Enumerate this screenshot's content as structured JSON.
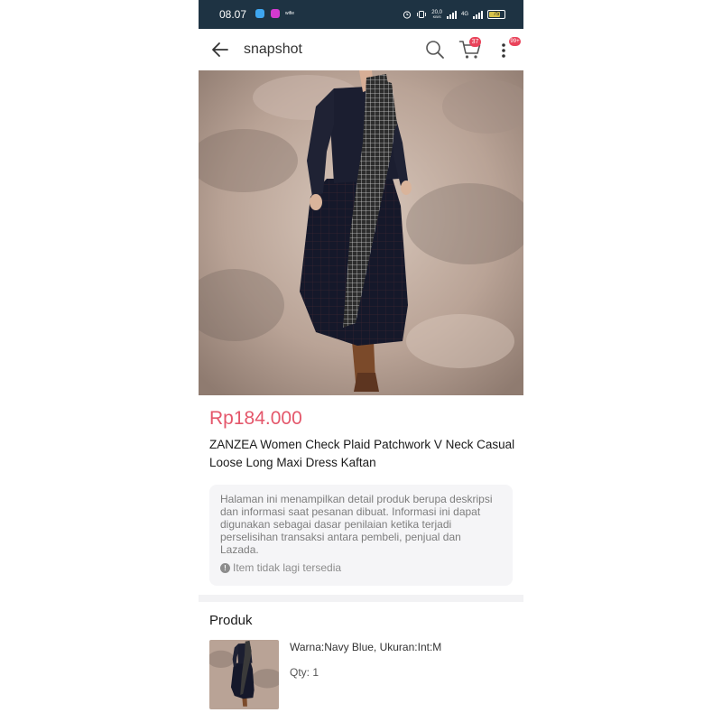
{
  "status_bar": {
    "time": "08.07",
    "wifi_name": "wifie",
    "speed_value": "20,0",
    "speed_unit": "KB/S",
    "network": "4G",
    "battery": "75",
    "battery_level_percent": 75
  },
  "header": {
    "title": "snapshot",
    "cart_count": "37",
    "notifications_count": "99+",
    "icons": [
      "arrow-left-icon",
      "search-icon",
      "cart-icon",
      "more-vertical-icon"
    ]
  },
  "product": {
    "price": "Rp184.000",
    "title": "ZANZEA Women Check Plaid Patchwork V Neck Casual Loose Long Maxi Dress Kaftan"
  },
  "notice": {
    "text": "Halaman ini menampilkan detail produk berupa deskripsi dan informasi saat pesanan dibuat. Informasi ini dapat digunakan sebagai dasar penilaian ketika terjadi perselisihan transaksi antara pembeli, penjual dan Lazada.",
    "status": "Item tidak lagi tersedia"
  },
  "products_section": {
    "title": "Produk",
    "item": {
      "variant": "Warna:Navy Blue, Ukuran:Int:M",
      "qty": "Qty: 1"
    }
  },
  "colors": {
    "status_bar_bg": "#1e3343",
    "price": "#e4576b",
    "badge": "#e9435a",
    "notice_bg": "#f5f5f7"
  }
}
